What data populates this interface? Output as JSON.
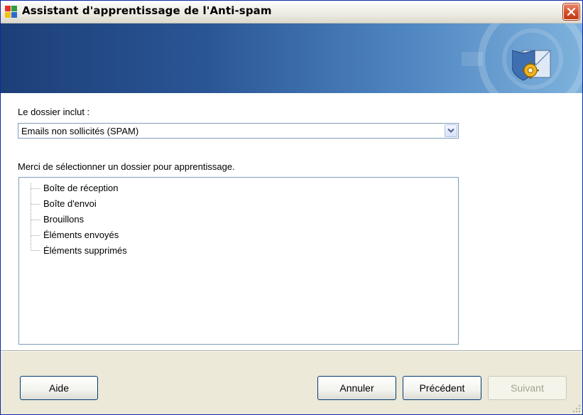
{
  "window": {
    "title": "Assistant d'apprentissage de l'Anti-spam"
  },
  "colors": {
    "banner_start": "#1d3f78",
    "banner_end": "#7eb2dc",
    "close_button": "#d4522e",
    "border_accent": "#7f9db9"
  },
  "icons": {
    "app": "avg-window-icon",
    "close": "close-icon",
    "banner": "mail-gear-shield-icon",
    "dropdown": "chevron-down-icon"
  },
  "folder_filter": {
    "label": "Le dossier inclut :",
    "selected": "Emails non sollicités (SPAM)"
  },
  "folder_list": {
    "instruction": "Merci de sélectionner un dossier pour apprentissage.",
    "items": [
      "Boîte de réception",
      "Boîte d'envoi",
      "Brouillons",
      "Éléments envoyés",
      "Éléments supprimés"
    ]
  },
  "buttons": {
    "help": "Aide",
    "cancel": "Annuler",
    "previous": "Précédent",
    "next": "Suivant"
  }
}
